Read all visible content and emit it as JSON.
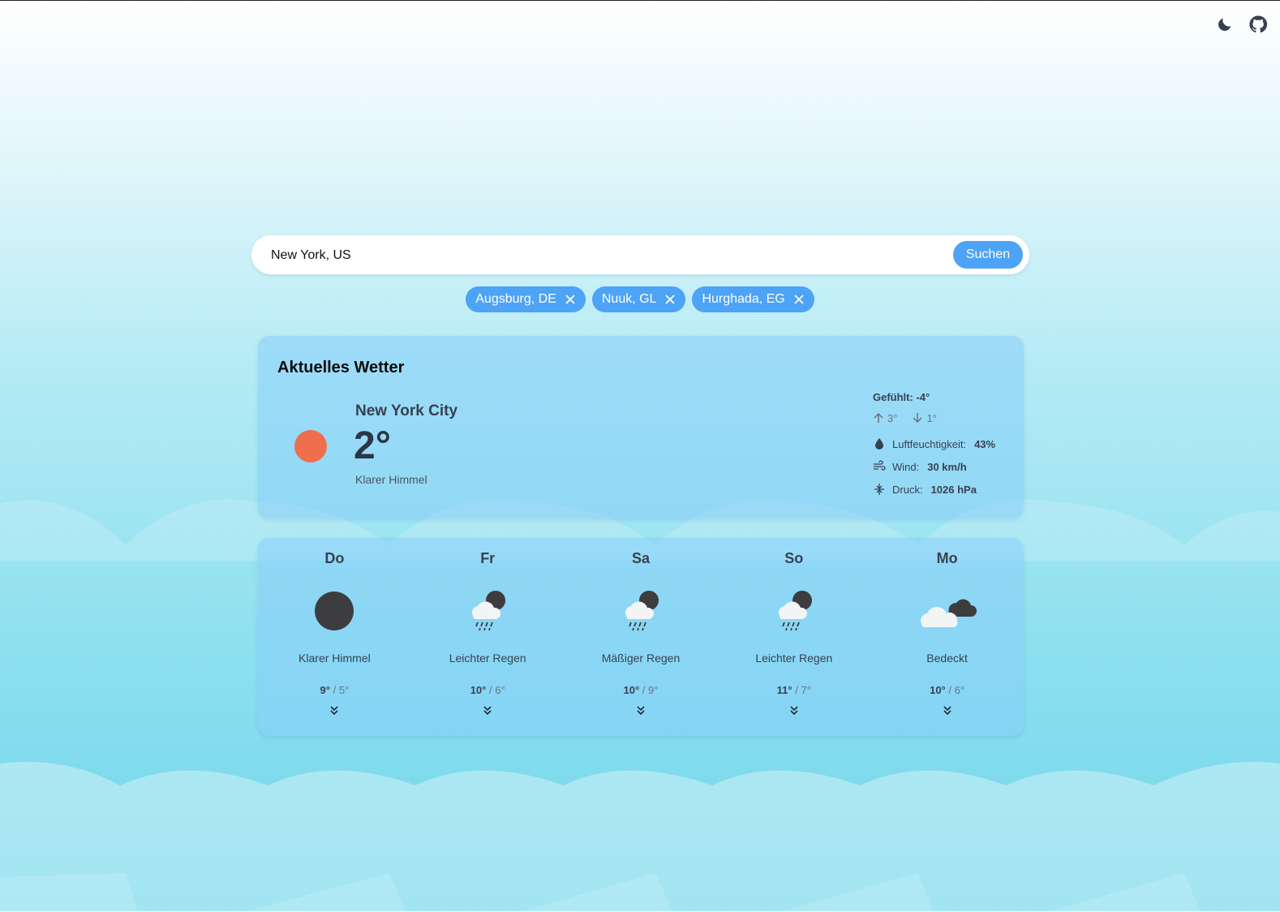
{
  "topbar": {
    "theme_icon": "moon-icon",
    "github_icon": "github-icon"
  },
  "search": {
    "value": "New York, US",
    "button_label": "Suchen"
  },
  "recent": [
    {
      "label": "Augsburg, DE"
    },
    {
      "label": "Nuuk, GL"
    },
    {
      "label": "Hurghada, EG"
    }
  ],
  "current": {
    "title": "Aktuelles Wetter",
    "city": "New York City",
    "temp": "2°",
    "description": "Klarer Himmel",
    "icon": "sun-icon",
    "feels_label": "Gefühlt: -4°",
    "high": "3°",
    "low": "1°",
    "humidity_label": "Luftfeuchtigkeit:",
    "humidity_value": "43%",
    "wind_label": "Wind:",
    "wind_value": "30 km/h",
    "pressure_label": "Druck:",
    "pressure_value": "1026 hPa"
  },
  "forecast": [
    {
      "day": "Do",
      "icon": "moon-icon",
      "description": "Klarer Himmel",
      "max": "9°",
      "min": "5°"
    },
    {
      "day": "Fr",
      "icon": "rain-night-icon",
      "description": "Leichter Regen",
      "max": "10°",
      "min": "6°"
    },
    {
      "day": "Sa",
      "icon": "rain-night-icon",
      "description": "Mäßiger Regen",
      "max": "10°",
      "min": "9°"
    },
    {
      "day": "So",
      "icon": "rain-night-icon",
      "description": "Leichter Regen",
      "max": "11°",
      "min": "7°"
    },
    {
      "day": "Mo",
      "icon": "cloudy-icon",
      "description": "Bedeckt",
      "max": "10°",
      "min": "6°"
    }
  ],
  "colors": {
    "accent": "#4da3f5",
    "sun": "#ef6e4b",
    "card": "#87cefa"
  }
}
